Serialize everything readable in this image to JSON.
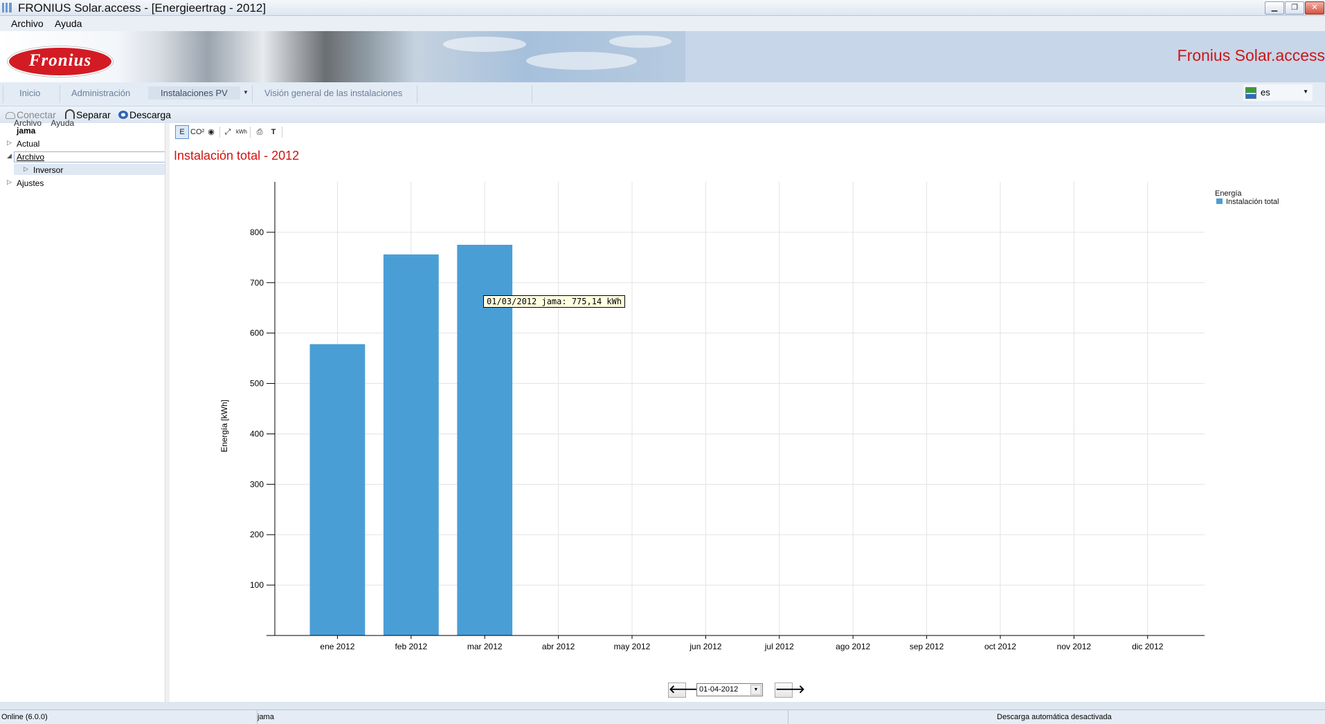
{
  "window": {
    "title": "FRONIUS Solar.access - [Energieertrag - 2012]",
    "min_label": "▁",
    "restore_label": "❐",
    "close_label": "✕"
  },
  "menu": {
    "items": [
      "Archivo",
      "Ayuda"
    ]
  },
  "banner": {
    "logo_text": "Fronius",
    "brand_text": "Fronius Solar.access"
  },
  "nav": {
    "tabs": [
      "Inicio",
      "Administración",
      "Instalaciones PV",
      "Visión general de las instalaciones"
    ],
    "active": "Instalaciones PV",
    "language": "es"
  },
  "toolbar": {
    "connect": "Conectar",
    "disconnect": "Separar",
    "download": "Descarga"
  },
  "tree": {
    "ghost_items": [
      "Archivo",
      "Ayuda"
    ],
    "root": "jama",
    "nodes": [
      "Actual",
      "Archivo",
      "Inversor",
      "Ajustes"
    ]
  },
  "chart_tools": [
    "E",
    "CO²",
    "◉",
    "⤢",
    "kWh",
    "⎙",
    "T"
  ],
  "chart_title": "Instalación total - 2012",
  "tooltip": "01/03/2012 jama: 775,14 kWh",
  "legend": {
    "title": "Energía",
    "series_label": "Instalación total"
  },
  "date_nav": {
    "prev": "🡐",
    "next": "🡒",
    "selected_date": "01-04-2012"
  },
  "status": {
    "connection": "Online (6.0.0)",
    "system": "jama",
    "auto_download": "Descarga automática desactivada"
  },
  "chart_data": {
    "type": "bar",
    "title": "Instalación total - 2012",
    "xlabel": "",
    "ylabel": "Energía [kWh]",
    "categories": [
      "ene 2012",
      "feb 2012",
      "mar 2012",
      "abr 2012",
      "may 2012",
      "jun 2012",
      "jul 2012",
      "ago 2012",
      "sep 2012",
      "oct 2012",
      "nov 2012",
      "dic 2012"
    ],
    "series": [
      {
        "name": "Instalación total",
        "values": [
          578,
          756,
          775.14,
          null,
          null,
          null,
          null,
          null,
          null,
          null,
          null,
          null
        ]
      }
    ],
    "ylim": [
      0,
      900
    ],
    "yticks": [
      100,
      200,
      300,
      400,
      500,
      600,
      700,
      800
    ],
    "grid": true,
    "legend_position": "top-right",
    "bar_color": "#4a9ed6"
  }
}
